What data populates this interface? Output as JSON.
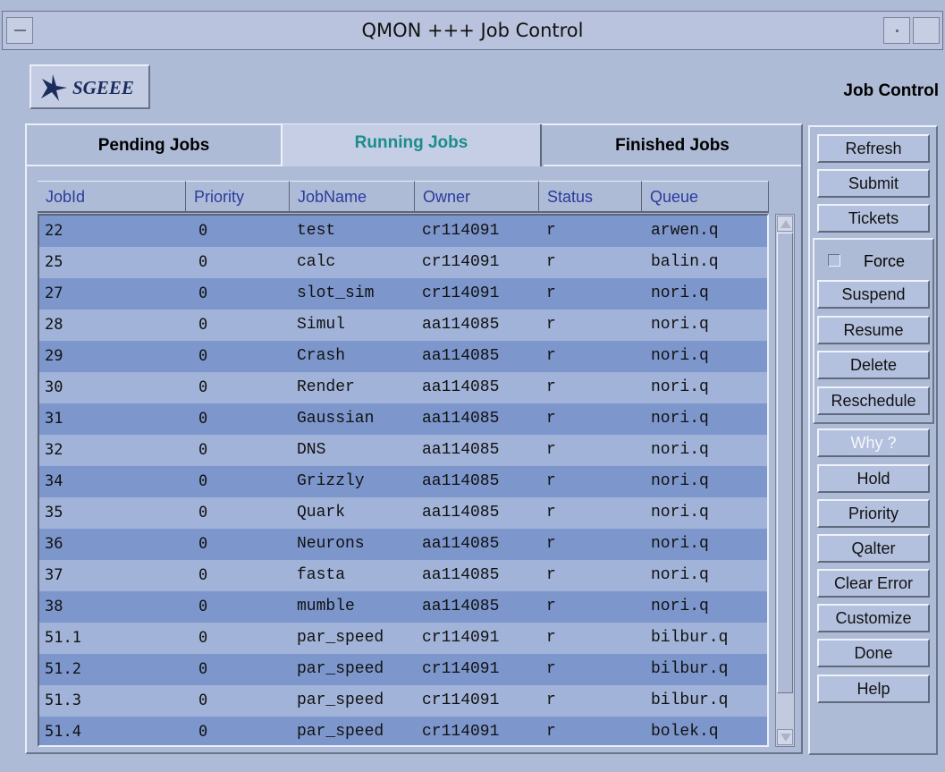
{
  "window": {
    "title": "QMON +++ Job Control"
  },
  "header": {
    "logo_text": "SGEEE",
    "title": "Job Control"
  },
  "tabs": [
    {
      "label": "Pending Jobs"
    },
    {
      "label": "Running Jobs"
    },
    {
      "label": "Finished Jobs"
    }
  ],
  "table": {
    "columns": [
      "JobId",
      "Priority",
      "JobName",
      "Owner",
      "Status",
      "Queue"
    ],
    "rows": [
      [
        "22",
        "0",
        "test",
        "cr114091",
        "r",
        "arwen.q"
      ],
      [
        "25",
        "0",
        "calc",
        "cr114091",
        "r",
        "balin.q"
      ],
      [
        "27",
        "0",
        "slot_sim",
        "cr114091",
        "r",
        "nori.q"
      ],
      [
        "28",
        "0",
        "Simul",
        "aa114085",
        "r",
        "nori.q"
      ],
      [
        "29",
        "0",
        "Crash",
        "aa114085",
        "r",
        "nori.q"
      ],
      [
        "30",
        "0",
        "Render",
        "aa114085",
        "r",
        "nori.q"
      ],
      [
        "31",
        "0",
        "Gaussian",
        "aa114085",
        "r",
        "nori.q"
      ],
      [
        "32",
        "0",
        "DNS",
        "aa114085",
        "r",
        "nori.q"
      ],
      [
        "34",
        "0",
        "Grizzly",
        "aa114085",
        "r",
        "nori.q"
      ],
      [
        "35",
        "0",
        "Quark",
        "aa114085",
        "r",
        "nori.q"
      ],
      [
        "36",
        "0",
        "Neurons",
        "aa114085",
        "r",
        "nori.q"
      ],
      [
        "37",
        "0",
        "fasta",
        "aa114085",
        "r",
        "nori.q"
      ],
      [
        "38",
        "0",
        "mumble",
        "aa114085",
        "r",
        "nori.q"
      ],
      [
        "51.1",
        "0",
        "par_speed",
        "cr114091",
        "r",
        "bilbur.q"
      ],
      [
        "51.2",
        "0",
        "par_speed",
        "cr114091",
        "r",
        "bilbur.q"
      ],
      [
        "51.3",
        "0",
        "par_speed",
        "cr114091",
        "r",
        "bilbur.q"
      ],
      [
        "51.4",
        "0",
        "par_speed",
        "cr114091",
        "r",
        "bolek.q"
      ]
    ]
  },
  "buttons": {
    "refresh": "Refresh",
    "submit": "Submit",
    "tickets": "Tickets",
    "force": "Force",
    "suspend": "Suspend",
    "resume": "Resume",
    "delete": "Delete",
    "reschedule": "Reschedule",
    "why": "Why ?",
    "hold": "Hold",
    "priority": "Priority",
    "qalter": "Qalter",
    "clear_error": "Clear Error",
    "customize": "Customize",
    "done": "Done",
    "help": "Help"
  },
  "colors": {
    "background": "#aebbd6",
    "row_dark": "#7d97cd",
    "row_light": "#a1b3d8",
    "active_tab_text": "#1b8c8c",
    "header_text": "#2b3b9e"
  },
  "icons": {
    "logo": "bird-icon"
  }
}
